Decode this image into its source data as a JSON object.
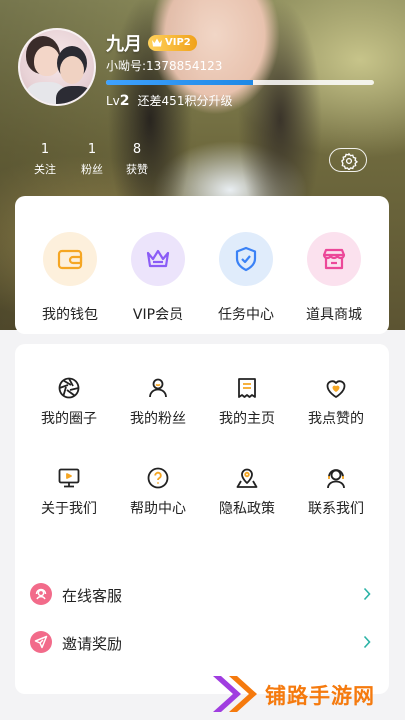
{
  "profile": {
    "name": "九月",
    "vip_label": "VIP2",
    "uid_text": "小呦号:1378854123",
    "level_prefix": "Lv",
    "level_num": "2",
    "points_text": "还差451积分升级",
    "level_progress": 0.55
  },
  "stats": [
    {
      "num": "1",
      "label": "关注"
    },
    {
      "num": "1",
      "label": "粉丝"
    },
    {
      "num": "8",
      "label": "获赞"
    }
  ],
  "main_features": [
    {
      "label": "我的钱包",
      "icon": "wallet-icon",
      "color": "#f5a623",
      "bg": "#fdf0dc"
    },
    {
      "label": "VIP会员",
      "icon": "crown-icon",
      "color": "#8b5cf6",
      "bg": "#ece4fb"
    },
    {
      "label": "任务中心",
      "icon": "shield-check-icon",
      "color": "#3b82f6",
      "bg": "#e0ecfb"
    },
    {
      "label": "道具商城",
      "icon": "store-icon",
      "color": "#ec4899",
      "bg": "#fbe1ee"
    }
  ],
  "grid_items": [
    {
      "label": "我的圈子",
      "icon": "aperture-icon"
    },
    {
      "label": "我的粉丝",
      "icon": "user-icon"
    },
    {
      "label": "我的主页",
      "icon": "homepage-icon"
    },
    {
      "label": "我点赞的",
      "icon": "heart-icon"
    },
    {
      "label": "关于我们",
      "icon": "monitor-icon"
    },
    {
      "label": "帮助中心",
      "icon": "help-icon"
    },
    {
      "label": "隐私政策",
      "icon": "location-icon"
    },
    {
      "label": "联系我们",
      "icon": "headset-icon"
    }
  ],
  "list_rows": [
    {
      "label": "在线客服",
      "icon": "service-icon",
      "color": "#f26b8a"
    },
    {
      "label": "邀请奖励",
      "icon": "send-icon",
      "color": "#f26b8a"
    }
  ],
  "watermark": {
    "text": "铺路手游网"
  },
  "colors": {
    "accent_yellow": "#f5a623",
    "progress_blue": "#1e88e5",
    "chevron": "#2bb3a6"
  }
}
